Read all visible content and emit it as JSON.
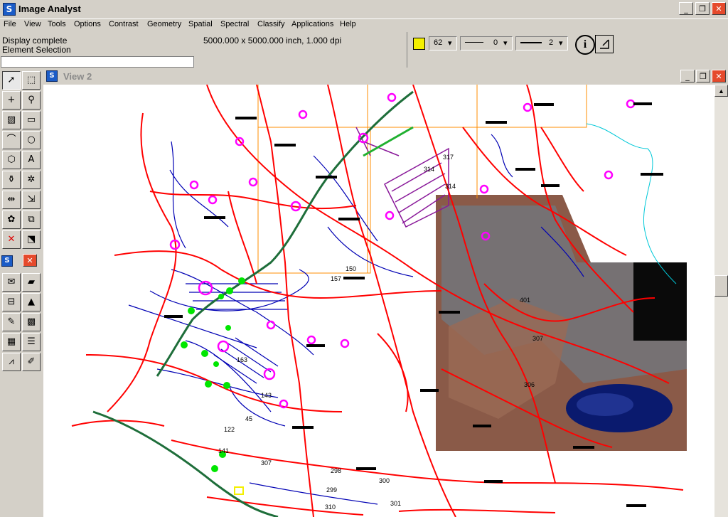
{
  "app": {
    "title": "Image Analyst",
    "icon_letter": "S"
  },
  "window_buttons": {
    "minimize": "_",
    "restore": "❐",
    "close": "✕"
  },
  "menu": [
    "File",
    "View",
    "Tools",
    "Options",
    "Contrast",
    "Geometry",
    "Spatial",
    "Spectral",
    "Classify",
    "Applications",
    "Help"
  ],
  "status": {
    "line1": "Display complete",
    "line2": "Element Selection",
    "dimensions": "5000.000 x 5000.000 inch, 1.000 dpi",
    "command": ""
  },
  "attributes": {
    "color_hex": "#f4f000",
    "color_value": "62",
    "line_style": "0",
    "line_weight": "2",
    "info_label": "i"
  },
  "view": {
    "title": "View 2",
    "icon_letter": "S"
  },
  "map": {
    "labels": [
      "317",
      "314",
      "314",
      "150",
      "157",
      "401",
      "307",
      "306",
      "143",
      "45",
      "141",
      "122",
      "307",
      "299",
      "300",
      "298",
      "310",
      "301",
      "163"
    ],
    "colors": {
      "roads": "#ff0000",
      "streams": "#0000b4",
      "highway": "#1e6e3a",
      "boundary": "#ff8c00",
      "sites": "#ff00ff",
      "markers": "#00e600",
      "water": "#0a1a6e"
    }
  }
}
